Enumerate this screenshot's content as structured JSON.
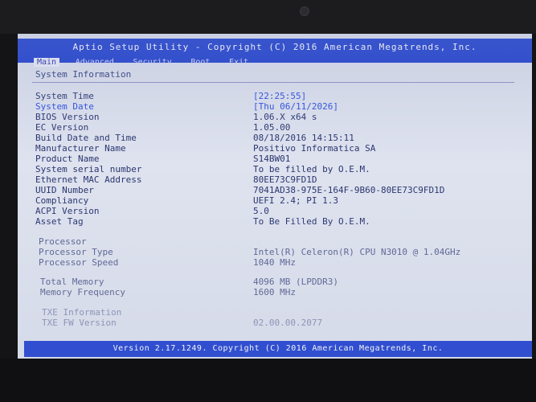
{
  "header": {
    "title": "Aptio Setup Utility - Copyright (C) 2016 American Megatrends, Inc.",
    "tabs": [
      "Main",
      "Advanced",
      "Security",
      "Boot",
      "Exit"
    ]
  },
  "section": {
    "title": "System Information"
  },
  "fields": [
    {
      "label": "System Time",
      "value": "[22:25:55]"
    },
    {
      "label": "System Date",
      "value": "[Thu 06/11/2026]"
    },
    {
      "label": "BIOS Version",
      "value": "1.06.X x64 s"
    },
    {
      "label": "EC Version",
      "value": "1.05.00"
    },
    {
      "label": "Build Date and Time",
      "value": "08/18/2016 14:15:11"
    },
    {
      "label": "Manufacturer Name",
      "value": "Positivo Informatica SA"
    },
    {
      "label": "Product Name",
      "value": "S14BW01"
    },
    {
      "label": "System serial number",
      "value": "To be filled by O.E.M."
    },
    {
      "label": "Ethernet MAC Address",
      "value": "80EE73C9FD1D"
    },
    {
      "label": "UUID Number",
      "value": "7041AD38-975E-164F-9B60-80EE73C9FD1D"
    },
    {
      "label": "Compliancy",
      "value": "UEFI 2.4; PI 1.3"
    },
    {
      "label": "ACPI Version",
      "value": "5.0"
    },
    {
      "label": "Asset Tag",
      "value": "To Be Filled By O.E.M."
    }
  ],
  "processor": {
    "heading": "Processor",
    "type_label": "Processor Type",
    "type_value": "Intel(R) Celeron(R) CPU N3010 @ 1.04GHz",
    "speed_label": "Processor Speed",
    "speed_value": "1040 MHz"
  },
  "memory": {
    "total_label": "Total Memory",
    "total_value": "4096 MB (LPDDR3)",
    "freq_label": "Memory Frequency",
    "freq_value": "1600 MHz"
  },
  "txe": {
    "heading": "TXE Information",
    "fw_label": "TXE FW Version",
    "fw_value": "02.00.00.2077"
  },
  "footer": {
    "text": "Version 2.17.1249. Copyright (C) 2016 American Megatrends, Inc."
  },
  "colors": {
    "title_bar": "#1e3fd0",
    "screen_bg": "#dfe3ef",
    "text": "#28346e",
    "highlight": "#2a4ee0"
  }
}
